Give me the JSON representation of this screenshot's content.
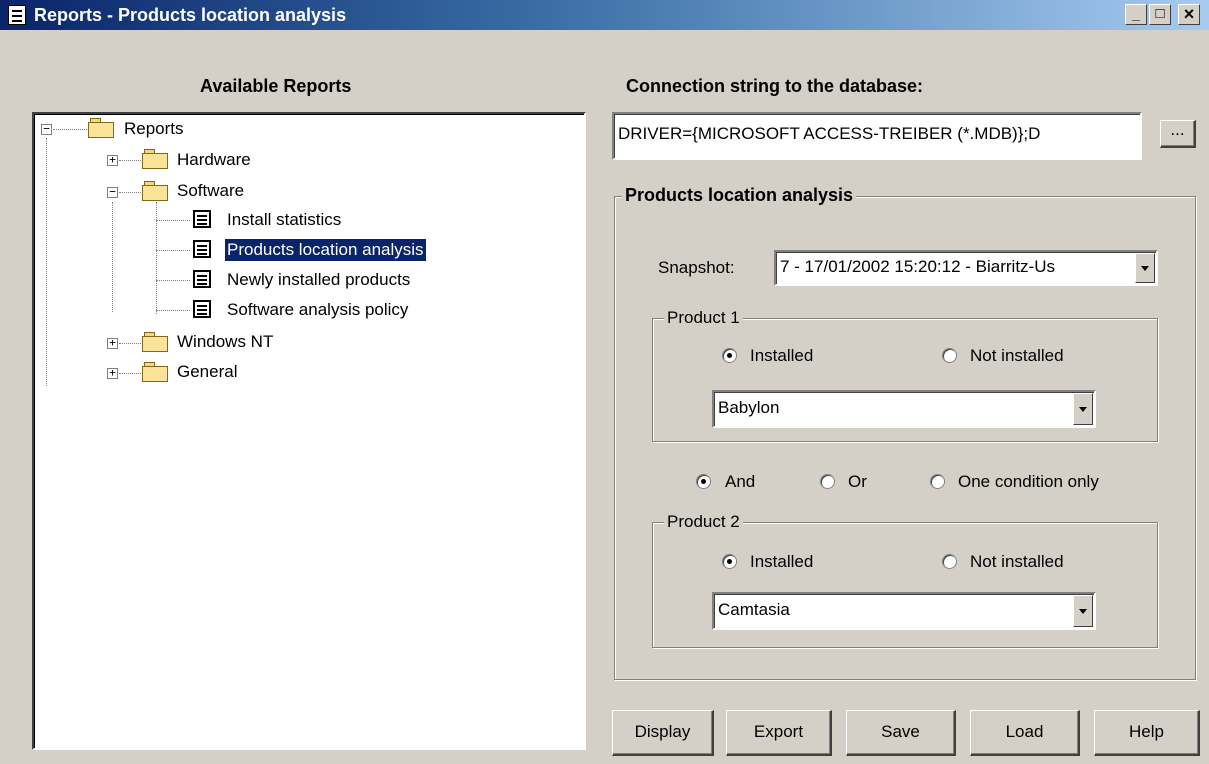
{
  "window": {
    "title": "Reports - Products location analysis",
    "minimize": "_",
    "maximize": "□",
    "close": "×"
  },
  "left": {
    "heading": "Available Reports",
    "tree": {
      "root": "Reports",
      "hardware": "Hardware",
      "software": "Software",
      "software_items": [
        "Install statistics",
        "Products location analysis",
        "Newly installed products",
        "Software analysis policy"
      ],
      "windows_nt": "Windows NT",
      "general": "General",
      "selected": "Products location analysis"
    }
  },
  "right": {
    "connection_label": "Connection string to the database:",
    "connection_value": "DRIVER={MICROSOFT ACCESS-TREIBER (*.MDB)};D",
    "browse_label": "...",
    "group_title": "Products location analysis",
    "snapshot_label": "Snapshot:",
    "snapshot_value": "7 - 17/01/2002 15:20:12 - Biarritz-Us",
    "product1": {
      "legend": "Product 1",
      "installed": "Installed",
      "not_installed": "Not installed",
      "selected": "Installed",
      "value": "Babylon"
    },
    "logic": {
      "and": "And",
      "or": "Or",
      "one": "One condition only",
      "selected": "And"
    },
    "product2": {
      "legend": "Product 2",
      "installed": "Installed",
      "not_installed": "Not installed",
      "selected": "Installed",
      "value": "Camtasia"
    }
  },
  "buttons": {
    "display": "Display",
    "export": "Export",
    "save": "Save",
    "load": "Load",
    "help": "Help"
  }
}
